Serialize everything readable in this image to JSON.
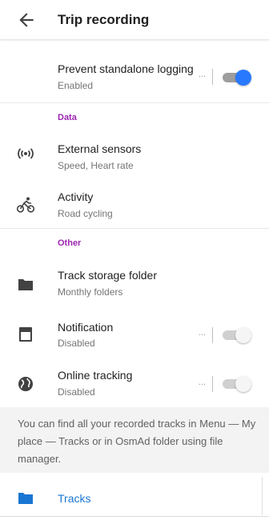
{
  "header": {
    "title": "Trip recording"
  },
  "standalone": {
    "title": "Prevent standalone logging",
    "subtitle": "Enabled",
    "overflow": "...",
    "toggle_on": true
  },
  "sections": {
    "data": "Data",
    "other": "Other"
  },
  "external_sensors": {
    "title": "External sensors",
    "subtitle": "Speed, Heart rate",
    "icon": "sensors-icon"
  },
  "activity": {
    "title": "Activity",
    "subtitle": "Road cycling",
    "icon": "cyclist-icon"
  },
  "storage": {
    "title": "Track storage folder",
    "subtitle": "Monthly folders",
    "icon": "folder-icon"
  },
  "notification": {
    "title": "Notification",
    "subtitle": "Disabled",
    "overflow": "...",
    "toggle_on": false,
    "icon": "notification-icon"
  },
  "online_tracking": {
    "title": "Online tracking",
    "subtitle": "Disabled",
    "overflow": "...",
    "toggle_on": false,
    "icon": "globe-icon"
  },
  "info": {
    "text": "You can find all your recorded tracks in Menu — My place — Tracks or in OsmAd folder using file manager."
  },
  "tracks": {
    "label": "Tracks",
    "icon": "folder-icon"
  },
  "colors": {
    "accent": "#2979ff",
    "section": "#9c27b0",
    "link": "#1976d2"
  }
}
